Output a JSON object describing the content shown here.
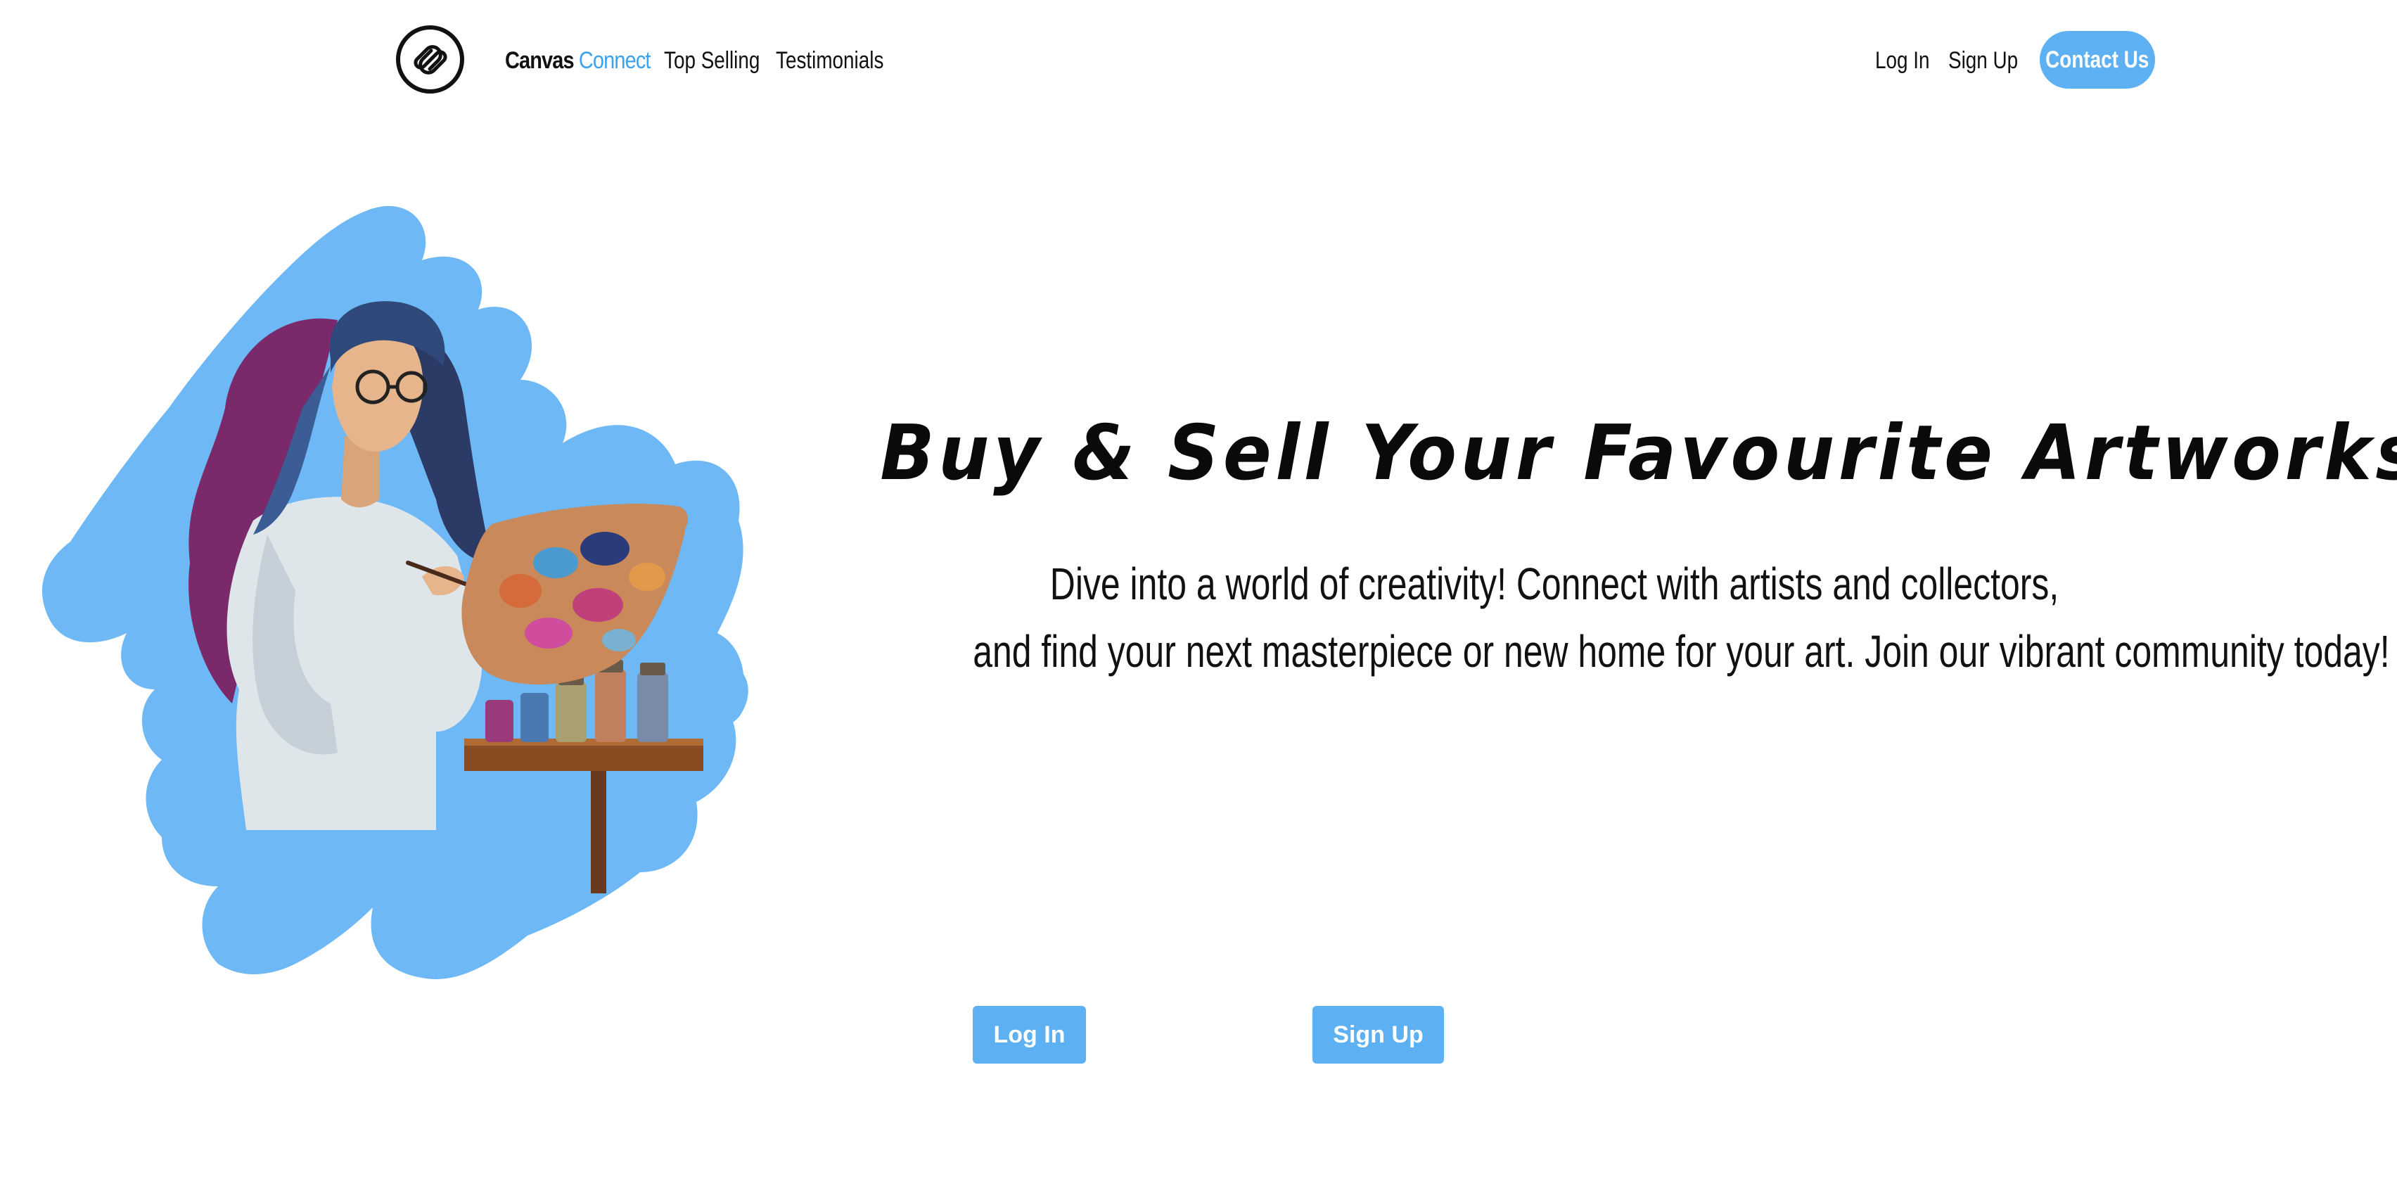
{
  "nav": {
    "brand_part1": "Canvas",
    "brand_part2": "Connect",
    "links": {
      "top_selling": "Top Selling",
      "testimonials": "Testimonials",
      "login": "Log In",
      "signup": "Sign Up"
    },
    "contact_label": "Contact Us",
    "logo_icon": "paperclip-link-icon"
  },
  "hero": {
    "title": "Buy & Sell Your Favourite Artworks",
    "subtitle_line1": "Dive into a world of creativity! Connect with artists and collectors,",
    "subtitle_line2": "and find your next masterpiece or new home for your art. Join our vibrant community today!",
    "illustration": "artist-woman-with-palette-illustration"
  },
  "cta": {
    "login_label": "Log In",
    "signup_label": "Sign Up"
  },
  "colors": {
    "accent": "#5db1f2",
    "brand_blue": "#3ba3ee",
    "blob": "#6db8f5",
    "text": "#111111",
    "background": "#ffffff"
  }
}
